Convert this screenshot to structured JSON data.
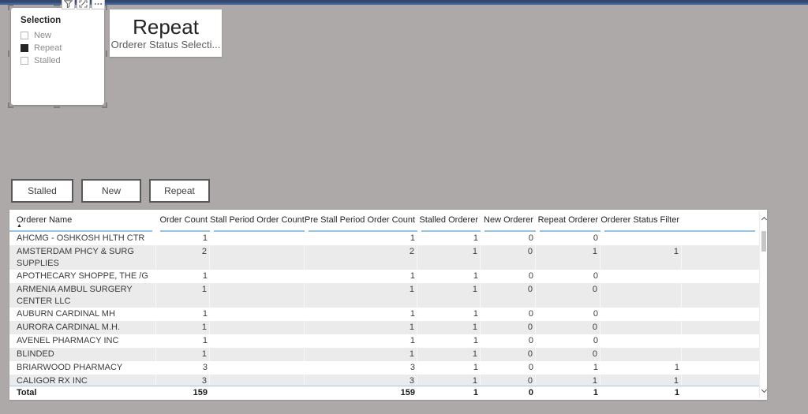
{
  "colors": {
    "canvas": "#ada9a9",
    "topbar": "#33486c",
    "topbar_accent": "#3f629a",
    "accent": "#94c3e8",
    "band": "#ebebeb",
    "ink": "#252423"
  },
  "visual_toolbar": {
    "icons": [
      "filter-icon",
      "focus-mode-icon",
      "more-options-icon"
    ]
  },
  "slicer": {
    "title": "Selection",
    "items": [
      {
        "label": "New",
        "checked": false
      },
      {
        "label": "Repeat",
        "checked": true
      },
      {
        "label": "Stalled",
        "checked": false
      }
    ]
  },
  "card": {
    "value": "Repeat",
    "caption": "Orderer Status Selecti..."
  },
  "buttons": [
    {
      "label": "Stalled"
    },
    {
      "label": "New"
    },
    {
      "label": "Repeat"
    }
  ],
  "table": {
    "columns": [
      "Orderer Name",
      "Order Count",
      "Stall Period Order Count",
      "Pre Stall Period Order Count",
      "Stalled Orderer",
      "New Orderer",
      "Repeat Orderer",
      "Orderer Status Filter"
    ],
    "sort": {
      "column": "Orderer Name",
      "direction": "ascending"
    },
    "rows": [
      {
        "name": "AHCMG - OSHKOSH HLTH CTR",
        "values": [
          "1",
          "",
          "1",
          "1",
          "0",
          "0",
          ""
        ]
      },
      {
        "name": "AMSTERDAM PHCY & SURG SUPPLIES",
        "values": [
          "2",
          "",
          "2",
          "1",
          "0",
          "1",
          "1"
        ]
      },
      {
        "name": "APOTHECARY SHOPPE, THE /G",
        "values": [
          "1",
          "",
          "1",
          "1",
          "0",
          "0",
          ""
        ]
      },
      {
        "name": "ARMENIA AMBUL SURGERY CENTER LLC",
        "values": [
          "1",
          "",
          "1",
          "1",
          "0",
          "0",
          ""
        ]
      },
      {
        "name": "AUBURN CARDINAL MH",
        "values": [
          "1",
          "",
          "1",
          "1",
          "0",
          "0",
          ""
        ]
      },
      {
        "name": "AURORA CARDINAL M.H.",
        "values": [
          "1",
          "",
          "1",
          "1",
          "0",
          "0",
          ""
        ]
      },
      {
        "name": "AVENEL PHARMACY INC",
        "values": [
          "1",
          "",
          "1",
          "1",
          "0",
          "0",
          ""
        ]
      },
      {
        "name": "BLINDED",
        "values": [
          "1",
          "",
          "1",
          "1",
          "0",
          "0",
          ""
        ]
      },
      {
        "name": "BRIARWOOD PHARMACY",
        "values": [
          "3",
          "",
          "3",
          "1",
          "0",
          "1",
          "1"
        ]
      },
      {
        "name": "CALIGOR RX INC",
        "values": [
          "3",
          "",
          "3",
          "1",
          "0",
          "1",
          "1"
        ]
      }
    ],
    "total_label": "Total",
    "total_values": [
      "159",
      "",
      "159",
      "1",
      "0",
      "1",
      "1"
    ]
  }
}
